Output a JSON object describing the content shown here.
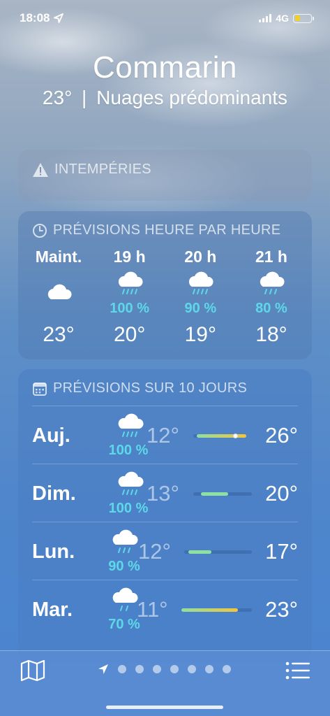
{
  "status_bar": {
    "time": "18:08",
    "network": "4G"
  },
  "header": {
    "city": "Commarin",
    "temperature": "23°",
    "separator": "|",
    "condition": "Nuages prédominants"
  },
  "alert": {
    "title": "INTEMPÉRIES"
  },
  "hourly": {
    "title": "PRÉVISIONS HEURE PAR HEURE",
    "items": [
      {
        "time": "Maint.",
        "icon": "cloud-icon",
        "precip": "",
        "temp": "23°"
      },
      {
        "time": "19 h",
        "icon": "rain-cloud-icon",
        "precip": "100 %",
        "temp": "20°"
      },
      {
        "time": "20 h",
        "icon": "rain-cloud-icon",
        "precip": "90 %",
        "temp": "19°"
      },
      {
        "time": "21 h",
        "icon": "rain-cloud-icon",
        "precip": "80 %",
        "temp": "18°"
      }
    ]
  },
  "daily": {
    "title": "PRÉVISIONS SUR 10 JOURS",
    "range": {
      "min": 11,
      "max": 26
    },
    "items": [
      {
        "day": "Auj.",
        "icon": "heavy-rain-cloud-icon",
        "precip": "100 %",
        "low": "12°",
        "high": "26°",
        "low_value": 12,
        "high_value": 26,
        "current_value": 23
      },
      {
        "day": "Dim.",
        "icon": "heavy-rain-cloud-icon",
        "precip": "100 %",
        "low": "13°",
        "high": "20°",
        "low_value": 13,
        "high_value": 20
      },
      {
        "day": "Lun.",
        "icon": "rain-cloud-icon",
        "precip": "90 %",
        "low": "12°",
        "high": "17°",
        "low_value": 12,
        "high_value": 17
      },
      {
        "day": "Mar.",
        "icon": "rain-cloud-icon",
        "precip": "70 %",
        "low": "11°",
        "high": "23°",
        "low_value": 11,
        "high_value": 23
      }
    ]
  },
  "bottom_bar": {
    "map_icon": "map-icon",
    "list_icon": "list-icon",
    "location_icon": "location-arrow-icon",
    "page_dots": 7
  },
  "colors": {
    "precip": "#5cd8e8",
    "bar_cool": "#8ee0a0",
    "bar_warm": "#f3c53c",
    "battery": "#f3cf2b"
  }
}
